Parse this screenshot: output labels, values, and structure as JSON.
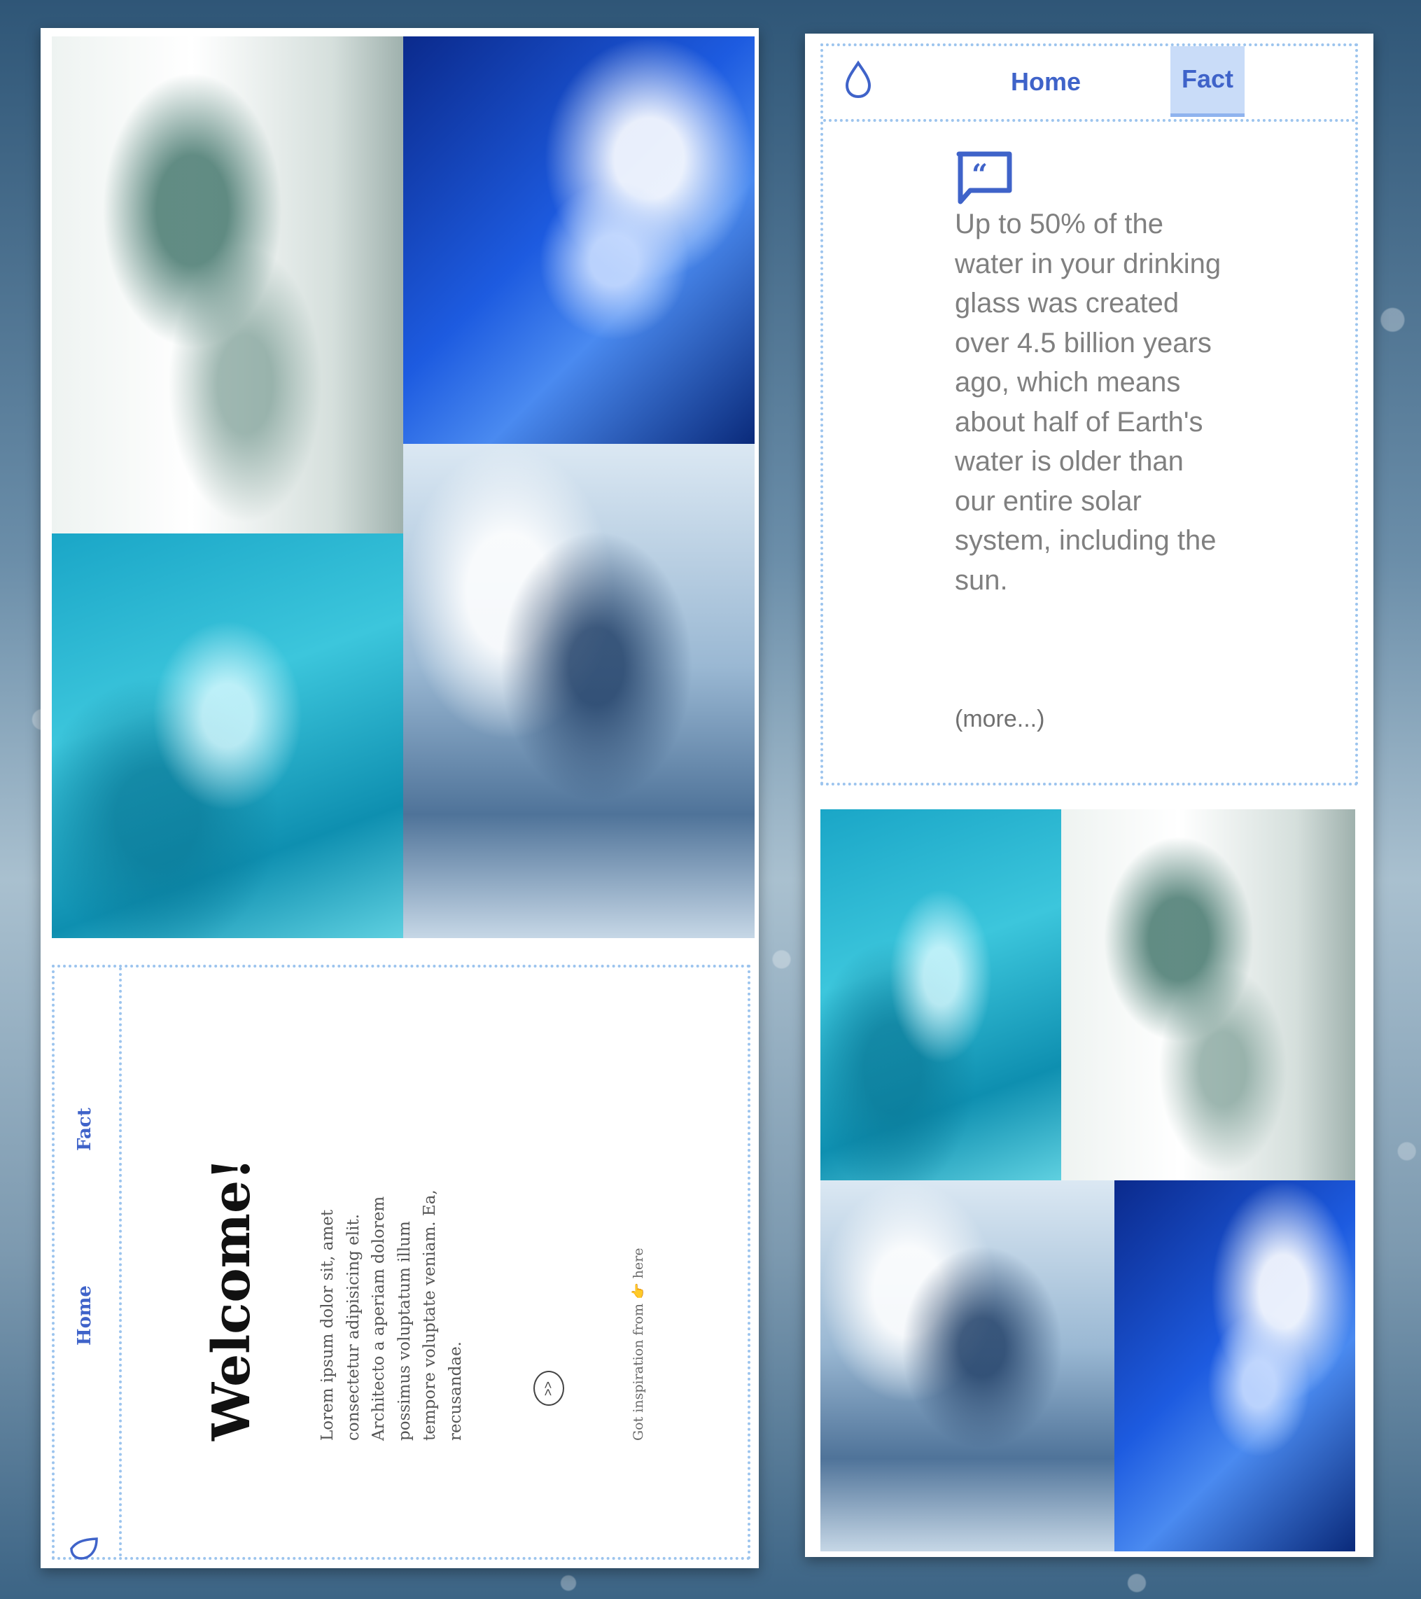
{
  "left_screen": {
    "nav": {
      "home": "Home",
      "fact": "Fact"
    },
    "heading": "Welcome!",
    "body_text": "Lorem ipsum dolor sit, amet consectetur adipisicing elit. Architecto a aperiam dolorem possimus voluptatum illum tempore voluptate veniam. Ea, recusandae.",
    "next_button": ">>",
    "credit": {
      "prefix": "Got inspiration from",
      "link": "here"
    }
  },
  "right_screen": {
    "nav": {
      "home": "Home",
      "fact": "Fact"
    },
    "fact_text": "Up to 50% of the water in your drinking glass was created over 4.5 billion years ago, which means about half of Earth's water is older than our entire solar system, including the sun.",
    "more_link": "(more...)"
  },
  "colors": {
    "accent": "#3f63c9",
    "dotted_border": "#9cc4ee",
    "active_tab_bg": "#c9dcf8",
    "text_gray": "#808080"
  },
  "icons": {
    "logo": "water-drop-icon",
    "quote": "quote-icon",
    "pointing": "pointing-hand-icon"
  }
}
